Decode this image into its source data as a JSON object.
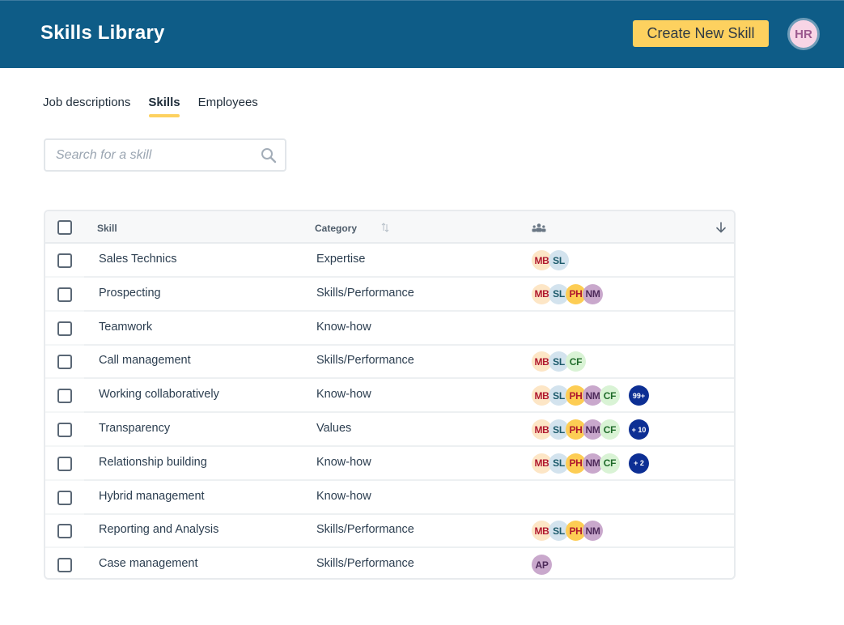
{
  "header": {
    "title": "Skills Library",
    "create_button": "Create New Skill",
    "user_initials": "HR"
  },
  "tabs": [
    {
      "label": "Job descriptions",
      "active": false
    },
    {
      "label": "Skills",
      "active": true
    },
    {
      "label": "Employees",
      "active": false
    }
  ],
  "search": {
    "placeholder": "Search for a skill",
    "value": ""
  },
  "colors": {
    "header_bg": "#0e5c87",
    "accent_yellow": "#fdd15f",
    "more_badge": "#0d2f94"
  },
  "avatar_styles": {
    "MB": {
      "bg": "#fde6c6",
      "fg": "#b0182e"
    },
    "SL": {
      "bg": "#d3e3ee",
      "fg": "#1c5a6b"
    },
    "PH": {
      "bg": "#fdcd54",
      "fg": "#b0182e"
    },
    "NM": {
      "bg": "#c9a8cc",
      "fg": "#4d2a5a"
    },
    "CF": {
      "bg": "#d9f3d5",
      "fg": "#1f6b2a"
    },
    "AP": {
      "bg": "#c9a8cc",
      "fg": "#4d2a5a"
    }
  },
  "table": {
    "columns": {
      "skill": "Skill",
      "category": "Category",
      "employees_icon": "people-icon"
    },
    "rows": [
      {
        "skill": "Sales Technics",
        "category": "Expertise",
        "avatars": [
          "MB",
          "SL"
        ],
        "more": ""
      },
      {
        "skill": "Prospecting",
        "category": "Skills/Performance",
        "avatars": [
          "MB",
          "SL",
          "PH",
          "NM"
        ],
        "more": ""
      },
      {
        "skill": "Teamwork",
        "category": "Know-how",
        "avatars": [],
        "more": ""
      },
      {
        "skill": "Call management",
        "category": "Skills/Performance",
        "avatars": [
          "MB",
          "SL",
          "CF"
        ],
        "more": ""
      },
      {
        "skill": "Working collaboratively",
        "category": "Know-how",
        "avatars": [
          "MB",
          "SL",
          "PH",
          "NM",
          "CF"
        ],
        "more": "99+"
      },
      {
        "skill": "Transparency",
        "category": "Values",
        "avatars": [
          "MB",
          "SL",
          "PH",
          "NM",
          "CF"
        ],
        "more": "+ 10"
      },
      {
        "skill": "Relationship building",
        "category": "Know-how",
        "avatars": [
          "MB",
          "SL",
          "PH",
          "NM",
          "CF"
        ],
        "more": "+ 2"
      },
      {
        "skill": "Hybrid management",
        "category": "Know-how",
        "avatars": [],
        "more": ""
      },
      {
        "skill": "Reporting and Analysis",
        "category": "Skills/Performance",
        "avatars": [
          "MB",
          "SL",
          "PH",
          "NM"
        ],
        "more": ""
      },
      {
        "skill": "Case management",
        "category": "Skills/Performance",
        "avatars": [
          "AP"
        ],
        "more": ""
      }
    ]
  }
}
